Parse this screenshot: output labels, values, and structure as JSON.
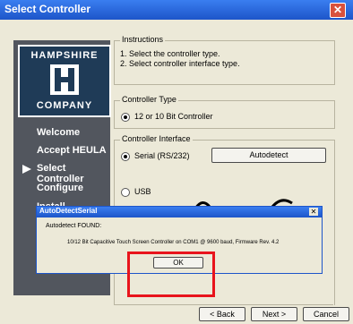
{
  "window": {
    "title": "Select Controller"
  },
  "logo": {
    "top": "HAMPSHIRE",
    "bottom": "COMPANY"
  },
  "nav": [
    "Welcome",
    "Accept HEULA",
    "Select Controller",
    "Configure",
    "Install"
  ],
  "instructions": {
    "title": "Instructions",
    "lines": [
      "1. Select the controller type.",
      "2. Select controller interface type."
    ]
  },
  "controller_type": {
    "title": "Controller Type",
    "option": "12 or 10 Bit Controller"
  },
  "controller_interface": {
    "title": "Controller Interface",
    "serial": "Serial (RS/232)",
    "autodetect": "Autodetect",
    "usb": "USB"
  },
  "dialog": {
    "title": "AutoDetectSerial",
    "found": "Autodetect FOUND:",
    "message": "10/12 Bit Capacitive Touch Screen Controller on COM1 @ 9600 baud, Firmware Rev. 4.2",
    "ok": "OK"
  },
  "buttons": {
    "back": "< Back",
    "next": "Next >",
    "cancel": "Cancel"
  }
}
